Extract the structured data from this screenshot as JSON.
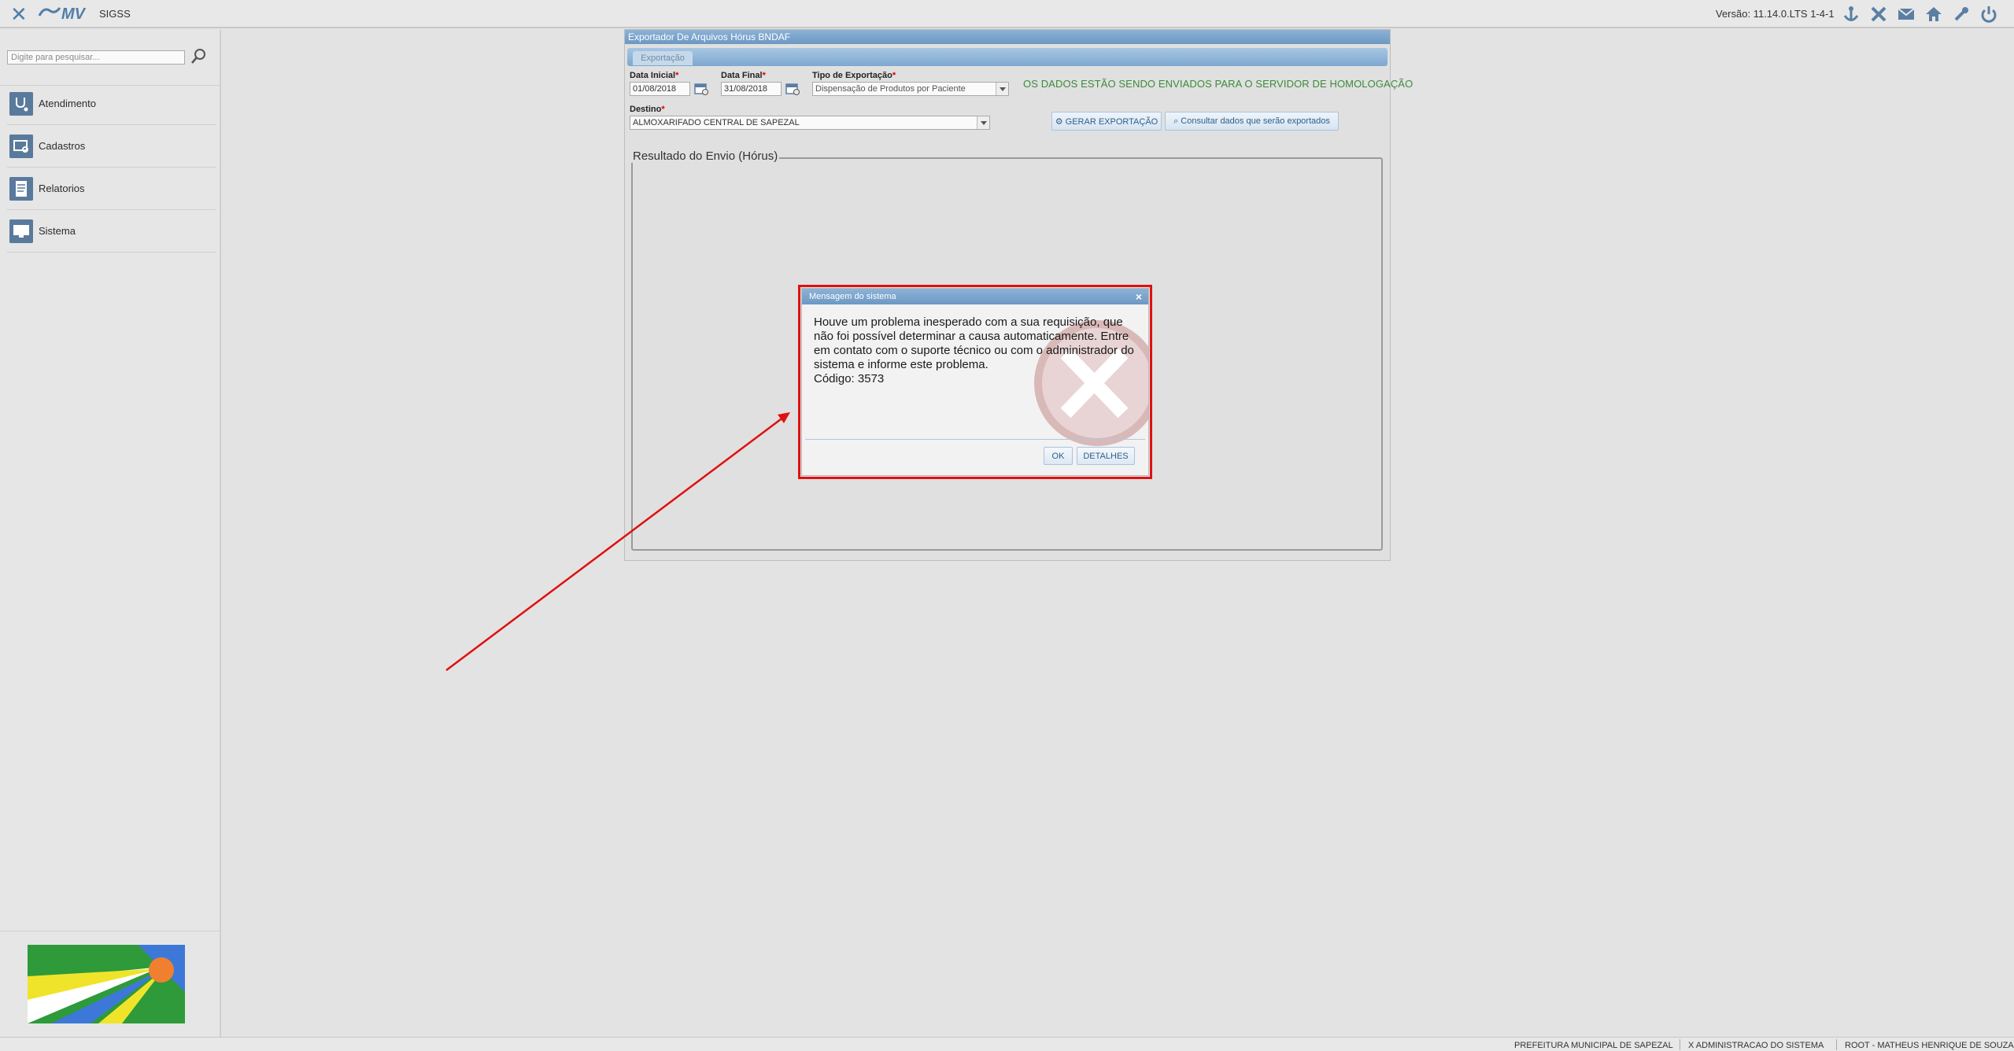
{
  "topbar": {
    "close_glyph": "✕",
    "logo_text": "MV",
    "app_name": "SIGSS",
    "version": "Versão: 11.14.0.LTS 1-4-1",
    "icons": [
      "anchor-icon",
      "tools-icon",
      "mail-icon",
      "home-icon",
      "wrench-icon",
      "power-icon"
    ]
  },
  "sidebar": {
    "search_placeholder": "Digite para pesquisar...",
    "items": [
      {
        "label": "Atendimento",
        "icon": "stethoscope-icon"
      },
      {
        "label": "Cadastros",
        "icon": "registry-icon"
      },
      {
        "label": "Relatorios",
        "icon": "report-icon"
      },
      {
        "label": "Sistema",
        "icon": "monitor-icon"
      }
    ]
  },
  "window": {
    "title": "Exportador De Arquivos Hórus BNDAF",
    "tab": "Exportação",
    "data_inicial_label": "Data Inicial",
    "data_inicial_value": "01/08/2018",
    "data_final_label": "Data Final",
    "data_final_value": "31/08/2018",
    "tipo_label": "Tipo de Exportação",
    "tipo_value": "Dispensação de Produtos por Paciente",
    "destino_label": "Destino",
    "destino_value": "ALMOXARIFADO CENTRAL DE SAPEZAL",
    "required_mark": "*",
    "notice": "OS DADOS ESTÃO SENDO ENVIADOS PARA O SERVIDOR DE HOMOLOGAÇÃO",
    "gerar_button": "⚙ GERAR EXPORTAÇÃO",
    "consultar_button": "⌕ Consultar dados que serão exportados",
    "result_legend": "Resultado do Envio (Hórus)"
  },
  "modal": {
    "title": "Mensagem do sistema",
    "close_glyph": "×",
    "message": "Houve um problema inesperado com a sua requisição, que não foi possível determinar a causa automaticamente. Entre em contato com o suporte técnico ou com o administrador do sistema e informe este problema.",
    "code": "Código: 3573",
    "ok_button": "OK",
    "details_button": "DETALHES"
  },
  "statusbar": {
    "org": "PREFEITURA MUNICIPAL DE SAPEZAL",
    "unit": "X ADMINISTRACAO DO SISTEMA",
    "user": "ROOT - MATHEUS HENRIQUE DE SOUZA"
  },
  "colors": {
    "accent_blue": "#6b98c4",
    "notice_green": "#3d8a3a",
    "highlight_red": "#e01010"
  }
}
